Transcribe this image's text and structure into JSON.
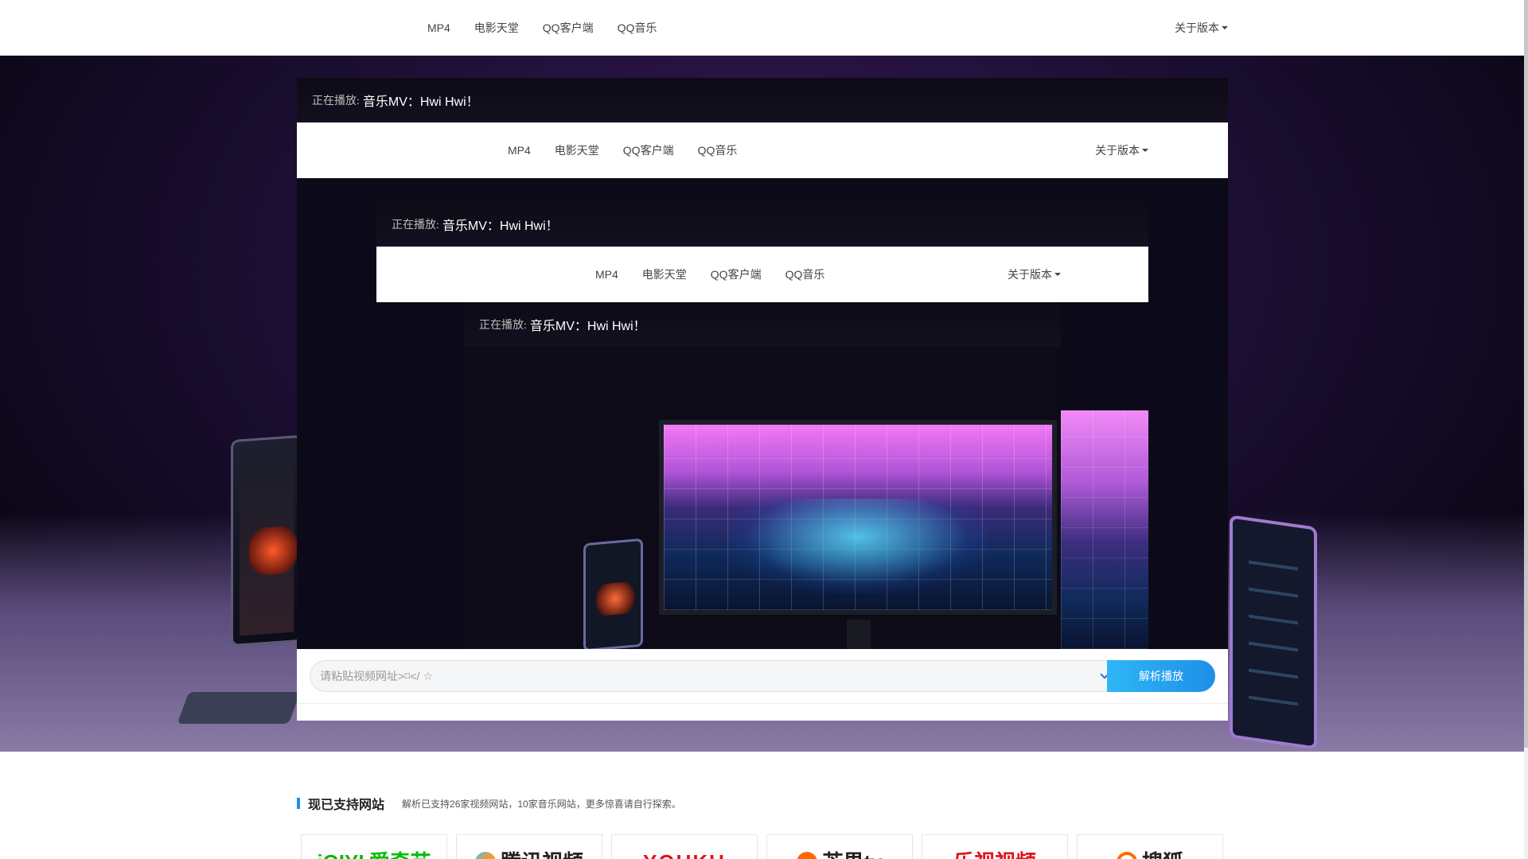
{
  "nav": {
    "links": [
      "MP4",
      "电影天堂",
      "QQ客户端",
      "QQ音乐"
    ],
    "about": "关于版本"
  },
  "player": {
    "now_playing_label": "正在播放:",
    "now_playing_title": "音乐MV：Hwi Hwi！"
  },
  "search": {
    "placeholder": "请粘贴视频网址>⌑</ ☆",
    "submit_label": "解析播放"
  },
  "supported": {
    "title": "现已支持网站",
    "description": "解析已支持26家视频网站，10家音乐网站，更多惊喜请自行探索。",
    "sites": [
      {
        "name": "iqiyi-card",
        "text": "爱奇艺",
        "mark": "iQIYI"
      },
      {
        "name": "tencent-video-card",
        "text": "腾讯视频"
      },
      {
        "name": "youku-card",
        "text": "YOUKU"
      },
      {
        "name": "mango-tv-card",
        "text": "芒果tv"
      },
      {
        "name": "letv-card",
        "text": "乐视视频"
      },
      {
        "name": "sohu-card",
        "text": "搜狐"
      }
    ]
  },
  "colors": {
    "accent": "#1d8fe8",
    "button_gradient_start": "#2fb6f5",
    "nav_bg": "#ffffff",
    "hero_bg": "#1c0f33"
  }
}
